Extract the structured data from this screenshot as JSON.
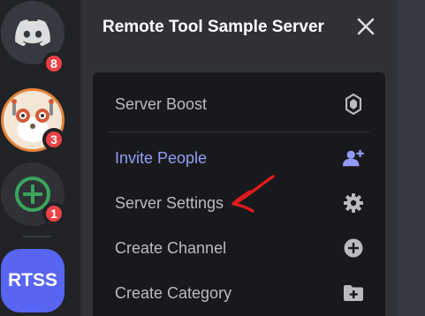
{
  "servers": [
    {
      "name": "home",
      "badge": "8"
    },
    {
      "name": "avatar-server",
      "badge": "3"
    },
    {
      "name": "add-server",
      "badge": "1"
    },
    {
      "name": "rtss",
      "label": "RTSS"
    }
  ],
  "sidebar": {
    "server_name": "Remote Tool Sample Server"
  },
  "menu": {
    "items": [
      {
        "label": "Server Boost",
        "icon": "boost-icon"
      },
      {
        "label": "Invite People",
        "icon": "add-person-icon",
        "color": "#949cf7"
      },
      {
        "label": "Server Settings",
        "icon": "gear-icon"
      },
      {
        "label": "Create Channel",
        "icon": "plus-circle-icon"
      },
      {
        "label": "Create Category",
        "icon": "folder-plus-icon"
      }
    ]
  },
  "annotation": {
    "type": "red-arrow",
    "points_to": "Server Settings",
    "color": "#e01b1b"
  },
  "colors": {
    "rail": "#202225",
    "sidebar": "#2f3136",
    "menu": "#18191c",
    "accent": "#5865f2",
    "badge": "#ed4245",
    "link": "#949cf7"
  }
}
